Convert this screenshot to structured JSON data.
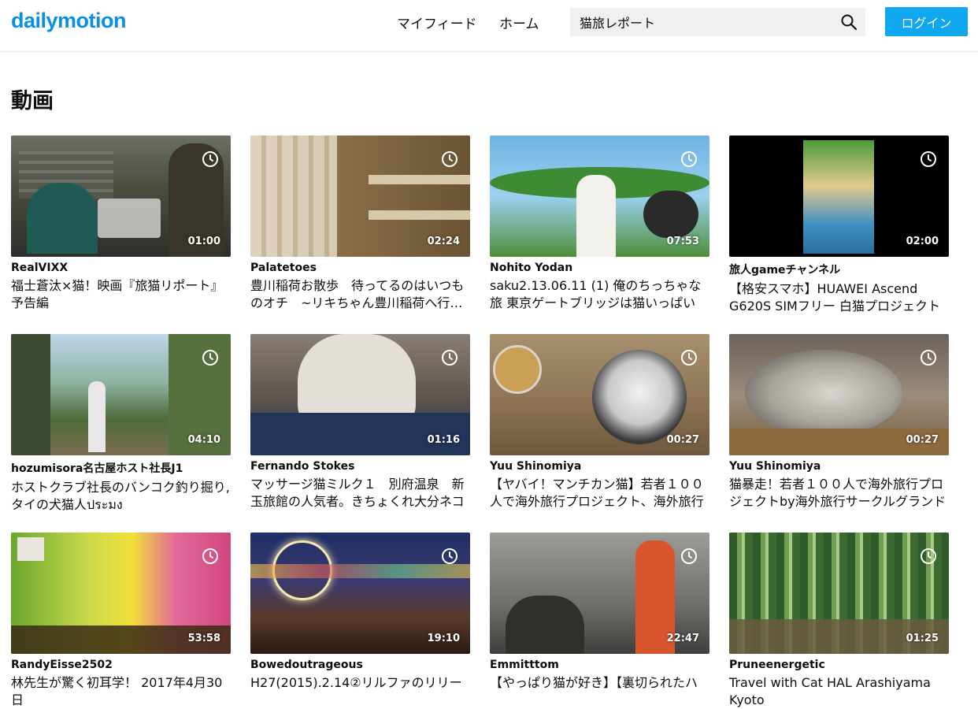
{
  "brand": {
    "logo": "dailymotion",
    "accent": "#0a8fe4",
    "button_color": "#0fa7ee"
  },
  "header": {
    "nav": [
      "マイフィード",
      "ホーム"
    ],
    "search": {
      "value": "猫旅レポート",
      "icon": "search-icon"
    },
    "login_label": "ログイン"
  },
  "section": {
    "title": "動画"
  },
  "videos": [
    {
      "owner": "RealVIXX",
      "title": "福士蒼汰×猫！映画『旅猫リポート』予告編",
      "duration": "01:00"
    },
    {
      "owner": "Palatetoes",
      "title": "豊川稲荷お散歩　待ってるのはいつものオチ　~リキちゃん豊川稲荷へ行く~",
      "duration": "02:24"
    },
    {
      "owner": "Nohito Yodan",
      "title": "saku2.13.06.11 (1) 俺のちっちゃな旅 東京ゲートブリッジは猫いっぱい",
      "duration": "07:53"
    },
    {
      "owner": "旅人gameチャンネル",
      "title": "【格安スマホ】HUAWEI Ascend G620S SIMフリー 白猫プロジェクト",
      "duration": "02:00"
    },
    {
      "owner": "hozumisora名古屋ホスト社長J1",
      "title": "ホストクラブ社長のバンコク釣り掘り,タイの犬猫人ประมง",
      "duration": "04:10"
    },
    {
      "owner": "Fernando Stokes",
      "title": "マッサージ猫ミルク１　別府温泉　新玉旅館の人気者。きちょくれ大分ネコ",
      "duration": "01:16"
    },
    {
      "owner": "Yuu Shinomiya",
      "title": "【ヤバイ！マンチカン猫】若者１００人で海外旅行プロジェクト、海外旅行",
      "duration": "00:27"
    },
    {
      "owner": "Yuu Shinomiya",
      "title": "猫暴走！若者１００人で海外旅行プロジェクトby海外旅行サークルグランド",
      "duration": "00:27"
    },
    {
      "owner": "RandyEisse2502",
      "title": "林先生が驚く初耳学！ 2017年4月30日",
      "duration": "53:58"
    },
    {
      "owner": "Bowedoutrageous",
      "title": "H27(2015).2.14②リルファのリリー",
      "duration": "19:10"
    },
    {
      "owner": "Emmitttom",
      "title": "【やっぱり猫が好き】【裏切られたハ",
      "duration": "22:47"
    },
    {
      "owner": "Pruneenergetic",
      "title": "Travel with Cat HAL Arashiyama Kyoto",
      "duration": "01:25"
    }
  ]
}
